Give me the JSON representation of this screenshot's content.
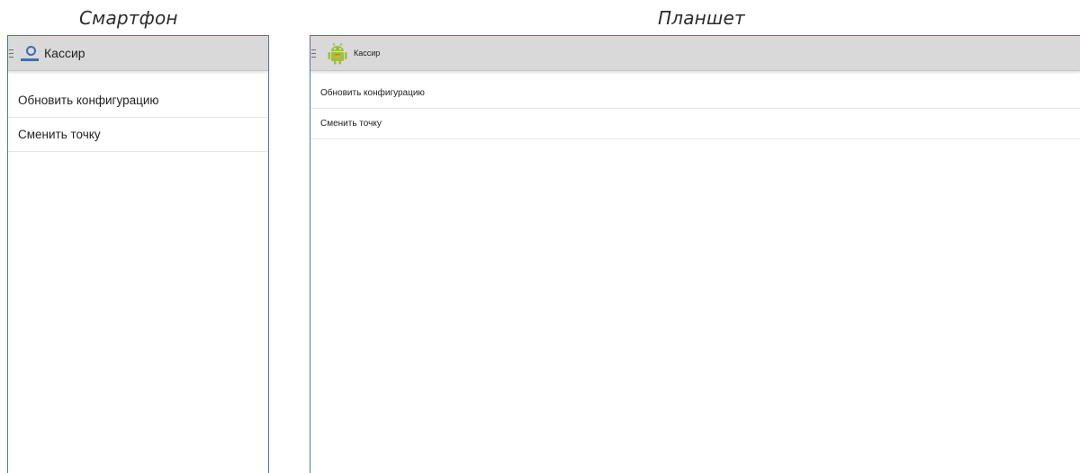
{
  "captions": {
    "phone": "Смартфон",
    "tablet": "Планшет"
  },
  "phone": {
    "app_title": "Кассир",
    "logo_icon": "cashier-logo-icon",
    "menu_items": [
      {
        "label": "Обновить конфигурацию"
      },
      {
        "label": "Сменить точку"
      }
    ]
  },
  "tablet": {
    "app_title": "Кассир",
    "logo_icon": "android-icon",
    "menu_items": [
      {
        "label": "Обновить конфигурацию"
      },
      {
        "label": "Сменить точку"
      }
    ]
  },
  "colors": {
    "appbar_bg": "#d9d9d9",
    "frame_border": "#4a7ab8",
    "logo_blue": "#3a6fb5",
    "android_green": "#9bc23c"
  }
}
